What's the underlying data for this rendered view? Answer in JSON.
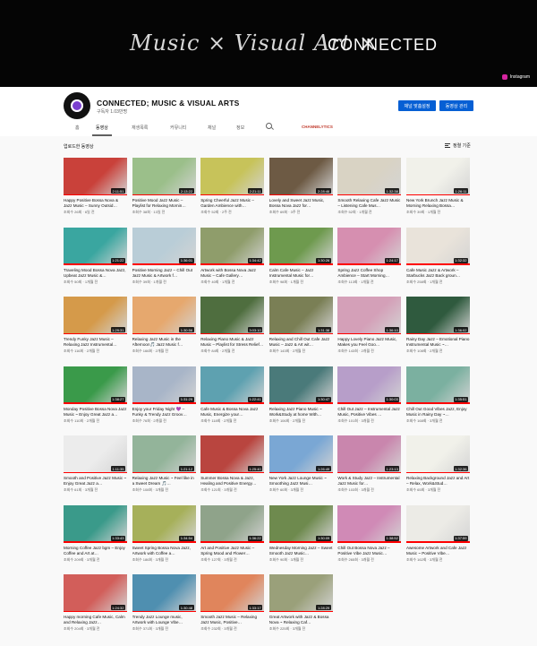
{
  "banner": {
    "title": "Music × Visual Art ×",
    "brand": "CONNECTED",
    "instagram": "Instagram"
  },
  "channel": {
    "name": "CONNECTED; MUSIC & VISUAL ARTS",
    "subs": "구독자 1.03만명",
    "customize_label": "채널 맞춤설정",
    "manage_label": "동영상 관리",
    "channelytics": "CHANNELYTICS"
  },
  "tabs": [
    "홈",
    "동영상",
    "재생목록",
    "커뮤니티",
    "채널",
    "정보"
  ],
  "section_title": "업로드한 동영상",
  "sort_label": "정렬 기준",
  "videos": [
    {
      "title": "Happy Positive Bossa Nova & Jazz Music – Sunny Outsid…",
      "meta": "조회수 26회 · 6일 전",
      "duration": "2:11:51",
      "color": "#c9413a"
    },
    {
      "title": "Positive Mood Jazz Music – Playlist for Relaxing Mornin…",
      "meta": "조회수 38회 · 13일 전",
      "duration": "2:13:22",
      "color": "#9bbf8a"
    },
    {
      "title": "Spring Cheerful Jazz Music – Garden Ambience with…",
      "meta": "조회수 52회 · 2주 전",
      "duration": "2:21:11",
      "color": "#c7c35a"
    },
    {
      "title": "Lovely and Sweet Jazz Music, Bossa Nova Jazz for…",
      "meta": "조회수 69회 · 3주 전",
      "duration": "2:28:46",
      "color": "#6d5a44"
    },
    {
      "title": "Smooth Relaxing Cafe Jazz Music – Listening Cafe Mus…",
      "meta": "조회수 52회 · 1개월 전",
      "duration": "1:32:38",
      "color": "#d9d3c4"
    },
    {
      "title": "New York Brunch Jazz Music & Morning Relaxing Bossa…",
      "meta": "조회수 39회 · 1개월 전",
      "duration": "1:26:11",
      "color": "#f1f1ea"
    },
    {
      "title": "Traveling Mood Bossa Nova Jazz, Upbeat Jazz Music &…",
      "meta": "조회수 50회 · 1개월 전",
      "duration": "1:21:22",
      "color": "#3aa6a0"
    },
    {
      "title": "Positive Morning Jazz – Chill Out Jazz Music & Artwork f…",
      "meta": "조회수 39회 · 1개월 전",
      "duration": "1:36:01",
      "color": "#b9cdd7"
    },
    {
      "title": "Artwork with Bossa Nova Jazz Music – Cafe Gallery…",
      "meta": "조회수 40회 · 1개월 전",
      "duration": "1:34:42",
      "color": "#8f9d6b"
    },
    {
      "title": "Calm Cafe Music – Jazz Instrumental Music for…",
      "meta": "조회수 98회 · 1개월 전",
      "duration": "1:30:26",
      "color": "#6e9a4e"
    },
    {
      "title": "Spring Jazz Coffee Shop Ambience – Start Morning…",
      "meta": "조회수 113회 · 1개월 전",
      "duration": "1:24:17",
      "color": "#d68fb0"
    },
    {
      "title": "Cafe Music Jazz & Artwork – Starbucks Jazz Back groun…",
      "meta": "조회수 258회 · 1개월 전",
      "duration": "1:32:32",
      "color": "#e9e3da"
    },
    {
      "title": "Trendy Funky Jazz Music – Relaxing Jazz Instrumental…",
      "meta": "조회수 116회 · 2개월 전",
      "duration": "1:29:31",
      "color": "#d59a4a"
    },
    {
      "title": "Relaxing Jazz Music in the Afternoon🎵 Jazz Music f…",
      "meta": "조회수 166회 · 2개월 전",
      "duration": "1:30:56",
      "color": "#e6a86e"
    },
    {
      "title": "Relaxing Piano Music & Jazz Music – Playlist for Stress Relief…",
      "meta": "조회수 84회 · 2개월 전",
      "duration": "3:03:10",
      "color": "#4f6e3f"
    },
    {
      "title": "Relaxing and Chill Out Cafe Jazz Music – Jazz & Art wit…",
      "meta": "조회수 143회 · 2개월 전",
      "duration": "1:31:38",
      "color": "#7a7f55"
    },
    {
      "title": "Happy Lovely Piano Jazz Music, Makes you Feel Goo…",
      "meta": "조회수 143회 · 2개월 전",
      "duration": "1:36:10",
      "color": "#d4a0b8"
    },
    {
      "title": "Rainy Day Jazz – Emotional Piano Instrumental Music ~…",
      "meta": "조회수 108회 · 2개월 전",
      "duration": "1:36:02",
      "color": "#2f5a3e"
    },
    {
      "title": "Monday Positive Bossa Nova Jazz Music ~ Enjoy Great Jazz a…",
      "meta": "조회수 110회 · 2개월 전",
      "duration": "1:38:27",
      "color": "#3a9a4a"
    },
    {
      "title": "Enjoy your Friday Night 💜 – Funky & Trendy Jazz Groov…",
      "meta": "조회수 76회 · 2개월 전",
      "duration": "1:31:29",
      "color": "#a8b5c8"
    },
    {
      "title": "Cafe Music & Bossa Nova Jazz Music, Energize your…",
      "meta": "조회수 118회 · 2개월 전",
      "duration": "1:22:41",
      "color": "#5ea1b0"
    },
    {
      "title": "Relaxing Jazz Piano Music ~ Work&Study at home With…",
      "meta": "조회수 106회 · 2개월 전",
      "duration": "1:30:47",
      "color": "#4a7a7a"
    },
    {
      "title": "Chill Out Jazz – Instrumental Jazz Music, Positive Vibes …",
      "meta": "조회수 101회 · 3개월 전",
      "duration": "1:30:03",
      "color": "#b79ec9"
    },
    {
      "title": "Chill Out Good Vibes Jazz, Enjoy Music in Rainy Day ~…",
      "meta": "조회수 168회 · 3개월 전",
      "duration": "1:35:51",
      "color": "#7bb0a0"
    },
    {
      "title": "Smooth and Positive Jazz Music ~ Enjoy Great Jazz a…",
      "meta": "조회수 61회 · 3개월 전",
      "duration": "1:11:35",
      "color": "#ececec"
    },
    {
      "title": "Relaxing Jazz Music ~ Feel like in a Sweet Dream 🎵…",
      "meta": "조회수 108회 · 3개월 전",
      "duration": "1:21:12",
      "color": "#93b49a"
    },
    {
      "title": "Summer Bossa Nova & Jazz, Healing and Positive Energy…",
      "meta": "조회수 121회 · 3개월 전",
      "duration": "1:25:40",
      "color": "#b9453f"
    },
    {
      "title": "New York Jazz Lounge Music ~ Smoothing Jazz Musi…",
      "meta": "조회수 60회 · 3개월 전",
      "duration": "1:26:49",
      "color": "#7aa7d4"
    },
    {
      "title": "Work & Study Jazz – Instrumental Jazz Music for…",
      "meta": "조회수 103회 · 3개월 전",
      "duration": "1:23:13",
      "color": "#c986ad"
    },
    {
      "title": "Relaxing Background Jazz and Art – Relax, Work&Stud…",
      "meta": "조회수 65회 · 3개월 전",
      "duration": "1:32:36",
      "color": "#f1f1ea"
    },
    {
      "title": "Morning Coffee Jazz bgm – Enjoy Coffee and Art at…",
      "meta": "조회수 209회 · 3개월 전",
      "duration": "1:33:43",
      "color": "#3a9a8a"
    },
    {
      "title": "Sweet Spring Bossa Nova Jazz, Artwork with Coffee a…",
      "meta": "조회수 186회 · 3개월 전",
      "duration": "1:34:54",
      "color": "#a6b05a"
    },
    {
      "title": "Art and Positive Jazz Music – Spring Mood and Flower…",
      "meta": "조회수 127회 · 3개월 전",
      "duration": "1:36:22",
      "color": "#8fa38a"
    },
    {
      "title": "Wednesday Morning Jazz – Sweet Smooth Jazz Music…",
      "meta": "조회수 90회 · 3개월 전",
      "duration": "1:30:09",
      "color": "#6e8a4e"
    },
    {
      "title": "Chill Out Bossa Nova Jazz – Positive Vibe Jazz Music…",
      "meta": "조회수 265회 · 3개월 전",
      "duration": "1:38:52",
      "color": "#d08ab6"
    },
    {
      "title": "Awesome Artwork and Cafe Jazz Music ~ Positive Vibe…",
      "meta": "조회수 162회 · 3개월 전",
      "duration": "1:37:59",
      "color": "#ecebe6"
    },
    {
      "title": "Happy morning Cafe Music, Calm and Relaxing Jazz…",
      "meta": "조회수 204회 · 3개월 전",
      "duration": "1:24:32",
      "color": "#d25e5a"
    },
    {
      "title": "Trendy Jazz Lounge music, Artwork with Lounge Vibe…",
      "meta": "조회수 371회 · 3개월 전",
      "duration": "1:30:48",
      "color": "#4f8fb0"
    },
    {
      "title": "Smooth Jazz Music – Relaxing Jazz Music, Positive…",
      "meta": "조회수 232회 · 3개월 전",
      "duration": "1:33:17",
      "color": "#e0855c"
    },
    {
      "title": "Great Artwork with Jazz & Bossa Nova ~ Relaxing Caf…",
      "meta": "조회수 225회 · 3개월 전",
      "duration": "1:28:29",
      "color": "#9aa07a"
    }
  ]
}
